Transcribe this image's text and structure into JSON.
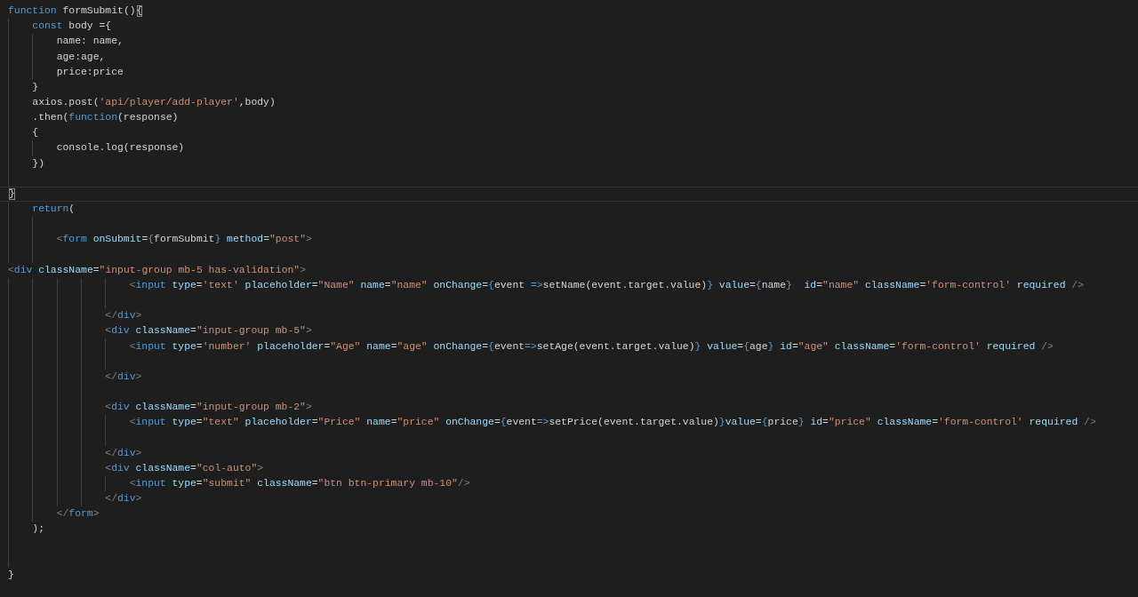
{
  "editor": {
    "lines": [
      {
        "current": false,
        "tokens": [
          {
            "kind": "keyword",
            "text": "function"
          },
          {
            "kind": "text",
            "text": " formSubmit()"
          },
          {
            "kind": "match",
            "text": "{"
          }
        ]
      },
      {
        "current": false,
        "tokens": [
          {
            "kind": "keyword",
            "text": "    const"
          },
          {
            "kind": "text",
            "text": " body ={"
          }
        ]
      },
      {
        "current": false,
        "tokens": [
          {
            "kind": "text",
            "text": "        name: name,"
          }
        ]
      },
      {
        "current": false,
        "tokens": [
          {
            "kind": "text",
            "text": "        age:age,"
          }
        ]
      },
      {
        "current": false,
        "tokens": [
          {
            "kind": "text",
            "text": "        price:price"
          }
        ]
      },
      {
        "current": false,
        "tokens": [
          {
            "kind": "text",
            "text": "    }"
          }
        ]
      },
      {
        "current": false,
        "tokens": [
          {
            "kind": "text",
            "text": "    axios.post("
          },
          {
            "kind": "string",
            "text": "'api/player/add-player'"
          },
          {
            "kind": "text",
            "text": ",body)"
          }
        ]
      },
      {
        "current": false,
        "tokens": [
          {
            "kind": "text",
            "text": "    .then("
          },
          {
            "kind": "keyword",
            "text": "function"
          },
          {
            "kind": "text",
            "text": "(response)"
          }
        ]
      },
      {
        "current": false,
        "tokens": [
          {
            "kind": "text",
            "text": "    {"
          }
        ]
      },
      {
        "current": false,
        "tokens": [
          {
            "kind": "text",
            "text": "        console.log(response)"
          }
        ]
      },
      {
        "current": false,
        "tokens": [
          {
            "kind": "text",
            "text": "    })"
          }
        ]
      },
      {
        "current": false
      },
      {
        "current": true,
        "tokens": [
          {
            "kind": "match",
            "text": "}"
          }
        ]
      },
      {
        "current": false,
        "tokens": [
          {
            "kind": "keyword",
            "text": "    return"
          },
          {
            "kind": "text",
            "text": "("
          }
        ]
      },
      {
        "current": false
      },
      {
        "current": false,
        "tokens": [
          {
            "kind": "angle",
            "text": "        <"
          },
          {
            "kind": "keyword",
            "text": "form"
          },
          {
            "kind": "attribute",
            "text": " onSubmit"
          },
          {
            "kind": "text",
            "text": "="
          },
          {
            "kind": "keyword",
            "text": "{"
          },
          {
            "kind": "text",
            "text": "formSubmit"
          },
          {
            "kind": "keyword",
            "text": "}"
          },
          {
            "kind": "attribute",
            "text": " method"
          },
          {
            "kind": "text",
            "text": "="
          },
          {
            "kind": "string",
            "text": "\"post\""
          },
          {
            "kind": "angle",
            "text": ">"
          }
        ]
      },
      {
        "current": false
      },
      {
        "current": false,
        "tokens": [
          {
            "kind": "angle",
            "text": "<"
          },
          {
            "kind": "keyword",
            "text": "div"
          },
          {
            "kind": "attribute",
            "text": " className"
          },
          {
            "kind": "text",
            "text": "="
          },
          {
            "kind": "string",
            "text": "\"input-group mb-5 has-validation\""
          },
          {
            "kind": "angle",
            "text": ">"
          }
        ]
      },
      {
        "current": false,
        "tokens": [
          {
            "kind": "angle",
            "text": "                    <"
          },
          {
            "kind": "keyword",
            "text": "input"
          },
          {
            "kind": "attribute",
            "text": " type"
          },
          {
            "kind": "text",
            "text": "="
          },
          {
            "kind": "string",
            "text": "'text'"
          },
          {
            "kind": "attribute",
            "text": " placeholder"
          },
          {
            "kind": "text",
            "text": "="
          },
          {
            "kind": "string",
            "text": "\"Name\""
          },
          {
            "kind": "attribute",
            "text": " name"
          },
          {
            "kind": "text",
            "text": "="
          },
          {
            "kind": "string",
            "text": "\"name\""
          },
          {
            "kind": "attribute",
            "text": " onChange"
          },
          {
            "kind": "text",
            "text": "="
          },
          {
            "kind": "keyword",
            "text": "{"
          },
          {
            "kind": "text",
            "text": "event "
          },
          {
            "kind": "keyword",
            "text": "=>"
          },
          {
            "kind": "text",
            "text": "setName(event.target.value)"
          },
          {
            "kind": "keyword",
            "text": "}"
          },
          {
            "kind": "attribute",
            "text": " value"
          },
          {
            "kind": "text",
            "text": "="
          },
          {
            "kind": "keyword",
            "text": "{"
          },
          {
            "kind": "text",
            "text": "name"
          },
          {
            "kind": "keyword",
            "text": "}"
          },
          {
            "kind": "attribute",
            "text": "  id"
          },
          {
            "kind": "text",
            "text": "="
          },
          {
            "kind": "string",
            "text": "\"name\""
          },
          {
            "kind": "attribute",
            "text": " className"
          },
          {
            "kind": "text",
            "text": "="
          },
          {
            "kind": "string",
            "text": "'form-control'"
          },
          {
            "kind": "attribute",
            "text": " required"
          },
          {
            "kind": "angle",
            "text": " />"
          }
        ]
      },
      {
        "current": false
      },
      {
        "current": false,
        "tokens": [
          {
            "kind": "angle",
            "text": "                </"
          },
          {
            "kind": "keyword",
            "text": "div"
          },
          {
            "kind": "angle",
            "text": ">"
          }
        ]
      },
      {
        "current": false,
        "tokens": [
          {
            "kind": "angle",
            "text": "                <"
          },
          {
            "kind": "keyword",
            "text": "div"
          },
          {
            "kind": "attribute",
            "text": " className"
          },
          {
            "kind": "text",
            "text": "="
          },
          {
            "kind": "string",
            "text": "\"input-group mb-5\""
          },
          {
            "kind": "angle",
            "text": ">"
          }
        ]
      },
      {
        "current": false,
        "tokens": [
          {
            "kind": "angle",
            "text": "                    <"
          },
          {
            "kind": "keyword",
            "text": "input"
          },
          {
            "kind": "attribute",
            "text": " type"
          },
          {
            "kind": "text",
            "text": "="
          },
          {
            "kind": "string",
            "text": "'number'"
          },
          {
            "kind": "attribute",
            "text": " placeholder"
          },
          {
            "kind": "text",
            "text": "="
          },
          {
            "kind": "string",
            "text": "\"Age\""
          },
          {
            "kind": "attribute",
            "text": " name"
          },
          {
            "kind": "text",
            "text": "="
          },
          {
            "kind": "string",
            "text": "\"age\""
          },
          {
            "kind": "attribute",
            "text": " onChange"
          },
          {
            "kind": "text",
            "text": "="
          },
          {
            "kind": "keyword",
            "text": "{"
          },
          {
            "kind": "text",
            "text": "event"
          },
          {
            "kind": "keyword",
            "text": "=>"
          },
          {
            "kind": "text",
            "text": "setAge(event.target.value)"
          },
          {
            "kind": "keyword",
            "text": "}"
          },
          {
            "kind": "attribute",
            "text": " value"
          },
          {
            "kind": "text",
            "text": "="
          },
          {
            "kind": "keyword",
            "text": "{"
          },
          {
            "kind": "text",
            "text": "age"
          },
          {
            "kind": "keyword",
            "text": "}"
          },
          {
            "kind": "attribute",
            "text": " id"
          },
          {
            "kind": "text",
            "text": "="
          },
          {
            "kind": "string",
            "text": "\"age\""
          },
          {
            "kind": "attribute",
            "text": " className"
          },
          {
            "kind": "text",
            "text": "="
          },
          {
            "kind": "string",
            "text": "'form-control'"
          },
          {
            "kind": "attribute",
            "text": " required"
          },
          {
            "kind": "angle",
            "text": " />"
          }
        ]
      },
      {
        "current": false
      },
      {
        "current": false,
        "tokens": [
          {
            "kind": "angle",
            "text": "                </"
          },
          {
            "kind": "keyword",
            "text": "div"
          },
          {
            "kind": "angle",
            "text": ">"
          }
        ]
      },
      {
        "current": false
      },
      {
        "current": false,
        "tokens": [
          {
            "kind": "angle",
            "text": "                <"
          },
          {
            "kind": "keyword",
            "text": "div"
          },
          {
            "kind": "attribute",
            "text": " className"
          },
          {
            "kind": "text",
            "text": "="
          },
          {
            "kind": "string",
            "text": "\"input-group mb-2\""
          },
          {
            "kind": "angle",
            "text": ">"
          }
        ]
      },
      {
        "current": false,
        "tokens": [
          {
            "kind": "angle",
            "text": "                    <"
          },
          {
            "kind": "keyword",
            "text": "input"
          },
          {
            "kind": "attribute",
            "text": " type"
          },
          {
            "kind": "text",
            "text": "="
          },
          {
            "kind": "string",
            "text": "\"text\""
          },
          {
            "kind": "attribute",
            "text": " placeholder"
          },
          {
            "kind": "text",
            "text": "="
          },
          {
            "kind": "string",
            "text": "\"Price\""
          },
          {
            "kind": "attribute",
            "text": " name"
          },
          {
            "kind": "text",
            "text": "="
          },
          {
            "kind": "string",
            "text": "\"price\""
          },
          {
            "kind": "attribute",
            "text": " onChange"
          },
          {
            "kind": "text",
            "text": "="
          },
          {
            "kind": "keyword",
            "text": "{"
          },
          {
            "kind": "text",
            "text": "event"
          },
          {
            "kind": "keyword",
            "text": "=>"
          },
          {
            "kind": "text",
            "text": "setPrice(event.target.value)"
          },
          {
            "kind": "keyword",
            "text": "}"
          },
          {
            "kind": "attribute",
            "text": "value"
          },
          {
            "kind": "text",
            "text": "="
          },
          {
            "kind": "keyword",
            "text": "{"
          },
          {
            "kind": "text",
            "text": "price"
          },
          {
            "kind": "keyword",
            "text": "}"
          },
          {
            "kind": "attribute",
            "text": " id"
          },
          {
            "kind": "text",
            "text": "="
          },
          {
            "kind": "string",
            "text": "\"price\""
          },
          {
            "kind": "attribute",
            "text": " className"
          },
          {
            "kind": "text",
            "text": "="
          },
          {
            "kind": "string",
            "text": "'form-control'"
          },
          {
            "kind": "attribute",
            "text": " required"
          },
          {
            "kind": "angle",
            "text": " />"
          }
        ]
      },
      {
        "current": false
      },
      {
        "current": false,
        "tokens": [
          {
            "kind": "angle",
            "text": "                </"
          },
          {
            "kind": "keyword",
            "text": "div"
          },
          {
            "kind": "angle",
            "text": ">"
          }
        ]
      },
      {
        "current": false,
        "tokens": [
          {
            "kind": "angle",
            "text": "                <"
          },
          {
            "kind": "keyword",
            "text": "div"
          },
          {
            "kind": "attribute",
            "text": " className"
          },
          {
            "kind": "text",
            "text": "="
          },
          {
            "kind": "string",
            "text": "\"col-auto\""
          },
          {
            "kind": "angle",
            "text": ">"
          }
        ]
      },
      {
        "current": false,
        "tokens": [
          {
            "kind": "angle",
            "text": "                    <"
          },
          {
            "kind": "keyword",
            "text": "input"
          },
          {
            "kind": "attribute",
            "text": " type"
          },
          {
            "kind": "text",
            "text": "="
          },
          {
            "kind": "string",
            "text": "\"submit\""
          },
          {
            "kind": "attribute",
            "text": " className"
          },
          {
            "kind": "text",
            "text": "="
          },
          {
            "kind": "string",
            "text": "\"btn btn-primary mb-10\""
          },
          {
            "kind": "angle",
            "text": "/>"
          }
        ]
      },
      {
        "current": false,
        "tokens": [
          {
            "kind": "angle",
            "text": "                </"
          },
          {
            "kind": "keyword",
            "text": "div"
          },
          {
            "kind": "angle",
            "text": ">"
          }
        ]
      },
      {
        "current": false,
        "tokens": [
          {
            "kind": "angle",
            "text": "        </"
          },
          {
            "kind": "keyword",
            "text": "form"
          },
          {
            "kind": "angle",
            "text": ">"
          }
        ]
      },
      {
        "current": false,
        "tokens": [
          {
            "kind": "text",
            "text": "    );"
          }
        ]
      },
      {
        "current": false
      },
      {
        "current": false
      },
      {
        "current": false,
        "tokens": [
          {
            "kind": "text",
            "text": "}"
          }
        ]
      }
    ]
  }
}
